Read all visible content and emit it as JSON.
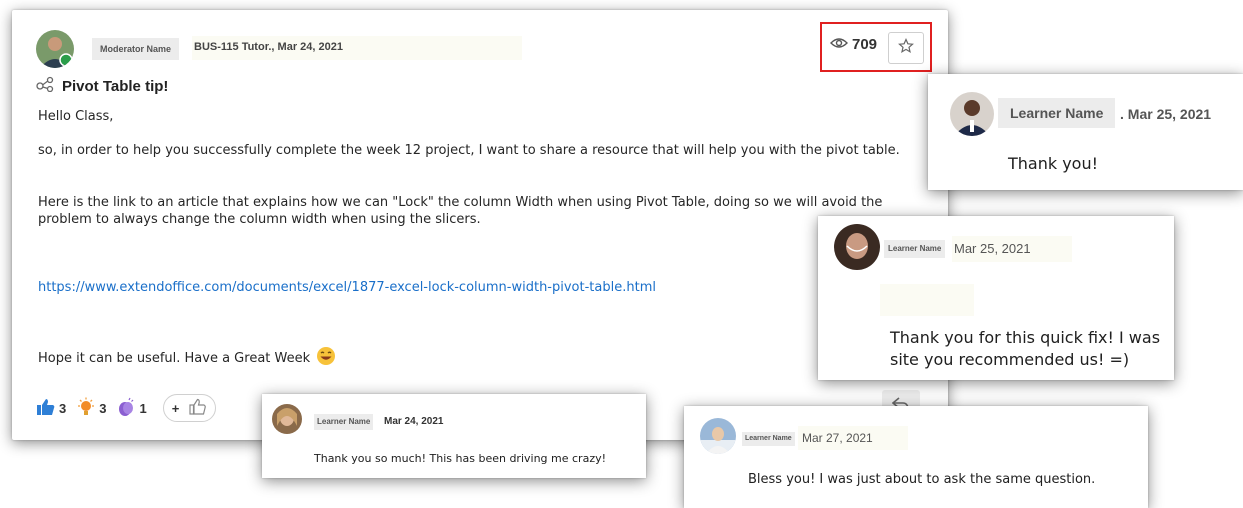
{
  "main_post": {
    "author": "Moderator Name",
    "meta": "BUS-115 Tutor., Mar 24, 2021",
    "views": "709",
    "title": "Pivot Table tip!",
    "greeting": "Hello Class,",
    "paragraph1": "so, in order to help you successfully complete the week 12 project, I want to share a resource that will help you with the pivot table.",
    "paragraph2": "Here is the link to an article that explains how we can \"Lock\" the column Width when using Pivot Table, doing so we will avoid the problem to always change the column width when using the slicers.",
    "link": "https://www.extendoffice.com/documents/excel/1877-excel-lock-column-width-pivot-table.html",
    "closing": "Hope it can be useful. Have a Great Week",
    "reactions": [
      {
        "icon": "thumbs-up-icon",
        "count": "3"
      },
      {
        "icon": "lightbulb-icon",
        "count": "3"
      },
      {
        "icon": "clap-icon",
        "count": "1"
      }
    ],
    "add_reaction_label": "+"
  },
  "replies": [
    {
      "author": "Learner Name",
      "date": ". Mar 25, 2021",
      "text": "Thank you!"
    },
    {
      "author": "Learner Name",
      "date": "Mar 25, 2021",
      "text_line1": "Thank you for this quick fix!  I was",
      "text_line2": "site you recommended us! =)"
    },
    {
      "author": "Learner Name",
      "date": "Mar 24, 2021",
      "text": "Thank you so much! This has been driving me crazy!"
    },
    {
      "author": "Learner Name",
      "date": "Mar 27, 2021",
      "text": "Bless you! I was just about to ask the same question."
    }
  ],
  "colors": {
    "link": "#1a6fc9",
    "highlight_border": "#e02020",
    "thumb_blue": "#2e7fd6"
  }
}
